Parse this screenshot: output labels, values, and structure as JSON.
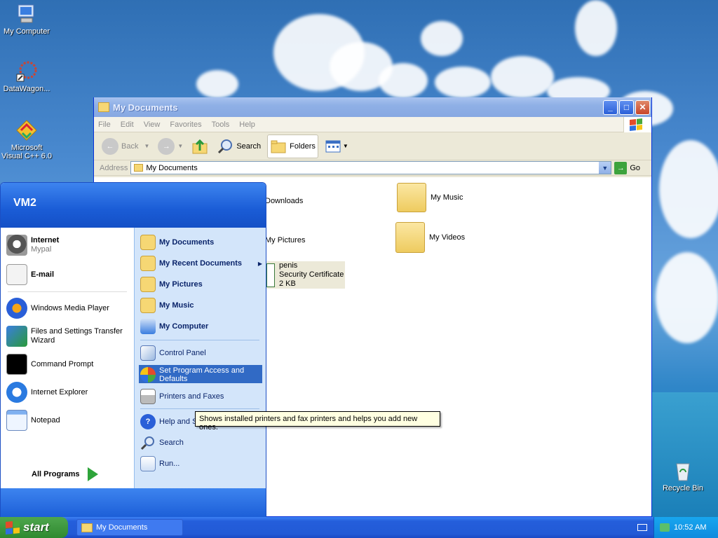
{
  "desktop": {
    "icons": [
      {
        "label": "My Computer",
        "icon": "my-computer-icon"
      },
      {
        "label": "DataWagon...",
        "icon": "datawagon-icon"
      },
      {
        "label": "Microsoft Visual C++ 6.0",
        "icon": "visual-cpp-icon"
      },
      {
        "label": "Recycle Bin",
        "icon": "recycle-bin-icon"
      }
    ]
  },
  "window": {
    "title": "My Documents",
    "menu": [
      "File",
      "Edit",
      "View",
      "Favorites",
      "Tools",
      "Help"
    ],
    "toolbar": {
      "back": "Back",
      "search": "Search",
      "folders": "Folders"
    },
    "address": {
      "label": "Address",
      "value": "My Documents",
      "go": "Go"
    },
    "files": [
      {
        "name": "Downloads",
        "icon": "folder-icon"
      },
      {
        "name": "My Music",
        "icon": "music-folder-icon"
      },
      {
        "name": "My Pictures",
        "icon": "pictures-folder-icon"
      },
      {
        "name": "My Videos",
        "icon": "videos-folder-icon"
      },
      {
        "name": "penis",
        "type": "Security Certificate",
        "size": "2 KB",
        "icon": "certificate-icon"
      }
    ]
  },
  "start_menu": {
    "user": "VM2",
    "pinned": [
      {
        "label": "Internet",
        "sub": "Mypal",
        "icon": "mypal-browser-icon"
      },
      {
        "label": "E-mail",
        "icon": "email-icon"
      }
    ],
    "recent": [
      {
        "label": "Windows Media Player",
        "icon": "media-player-icon"
      },
      {
        "label": "Files and Settings Transfer Wizard",
        "icon": "transfer-wizard-icon"
      },
      {
        "label": "Command Prompt",
        "icon": "command-prompt-icon"
      },
      {
        "label": "Internet Explorer",
        "icon": "internet-explorer-icon"
      },
      {
        "label": "Notepad",
        "icon": "notepad-icon"
      }
    ],
    "all_programs": "All Programs",
    "right": [
      {
        "label": "My Documents",
        "bold": true,
        "icon": "my-documents-icon"
      },
      {
        "label": "My Recent Documents",
        "bold": true,
        "icon": "recent-documents-icon"
      },
      {
        "label": "My Pictures",
        "bold": true,
        "icon": "my-pictures-icon"
      },
      {
        "label": "My Music",
        "bold": true,
        "icon": "my-music-icon"
      },
      {
        "label": "My Computer",
        "bold": true,
        "icon": "my-computer-icon"
      },
      {
        "label": "Control Panel",
        "icon": "control-panel-icon"
      },
      {
        "label": "Set Program Access and Defaults",
        "icon": "program-access-icon"
      },
      {
        "label": "Printers and Faxes",
        "icon": "printer-icon"
      },
      {
        "label": "Help and S",
        "icon": "help-icon"
      },
      {
        "label": "Search",
        "icon": "search-icon"
      },
      {
        "label": "Run...",
        "icon": "run-icon"
      }
    ],
    "tooltip": "Shows installed printers and fax printers and helps you add new ones."
  },
  "taskbar": {
    "start": "start",
    "task": "My Documents",
    "clock": "10:52 AM"
  },
  "colors": {
    "taskbar": "#245edb",
    "start_button": "#3a983a",
    "highlight": "#316ac5"
  }
}
